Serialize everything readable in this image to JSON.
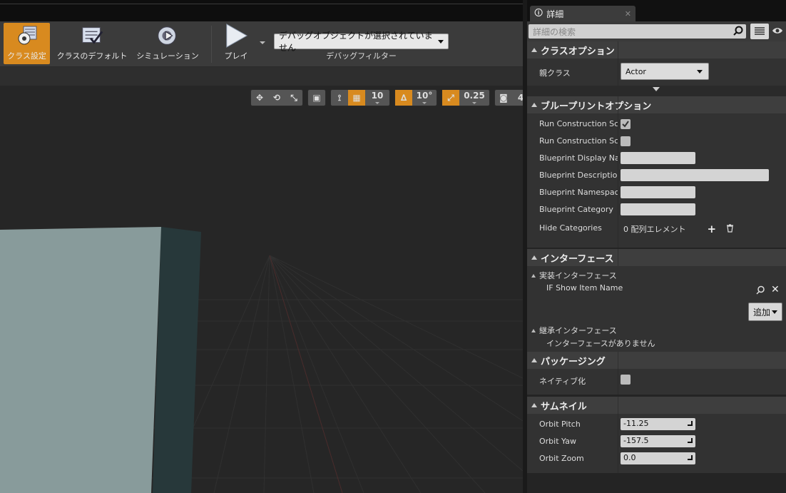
{
  "toolbar": {
    "class_settings": "クラス設定",
    "class_defaults": "クラスのデフォルト",
    "simulation": "シミュレーション",
    "play": "プレイ",
    "debug_select": "デバッグオブジェクトが選択されていません",
    "debug_filter": "デバッグフィルター"
  },
  "viewport": {
    "grid_snap": "10",
    "rotation_snap": "10°",
    "scale_snap": "0.25",
    "camera_speed": "4"
  },
  "details": {
    "tab_title": "詳細",
    "search_placeholder": "詳細の検索",
    "sections": {
      "class_options": "クラスオプション",
      "blueprint_options": "ブループリントオプション",
      "interfaces": "インターフェース",
      "packaging": "パッケージング",
      "thumbnail": "サムネイル"
    },
    "class_options": {
      "parent_class_label": "親クラス",
      "parent_class_value": "Actor"
    },
    "blueprint_options": {
      "run_construction_1": "Run Construction Script on Drag",
      "run_construction_2": "Run Construction Script in Sequencer",
      "display_name": "Blueprint Display Name",
      "description": "Blueprint Description",
      "namespace": "Blueprint Namespace",
      "category": "Blueprint Category",
      "hide_categories": "Hide Categories",
      "hide_categories_value": "0 配列エレメント"
    },
    "interfaces": {
      "implemented": "実装インターフェース",
      "item": "IF Show Item Name",
      "add": "追加",
      "inherited": "継承インターフェース",
      "none": "インターフェースがありません"
    },
    "packaging": {
      "nativize": "ネイティブ化"
    },
    "thumbnail": {
      "orbit_pitch_label": "Orbit Pitch",
      "orbit_pitch": "-11.25",
      "orbit_yaw_label": "Orbit Yaw",
      "orbit_yaw": "-157.5",
      "orbit_zoom_label": "Orbit Zoom",
      "orbit_zoom": "0.0"
    }
  },
  "colors": {
    "accent": "#d88a1f",
    "panel": "#323232",
    "section": "#3e3e3e"
  }
}
